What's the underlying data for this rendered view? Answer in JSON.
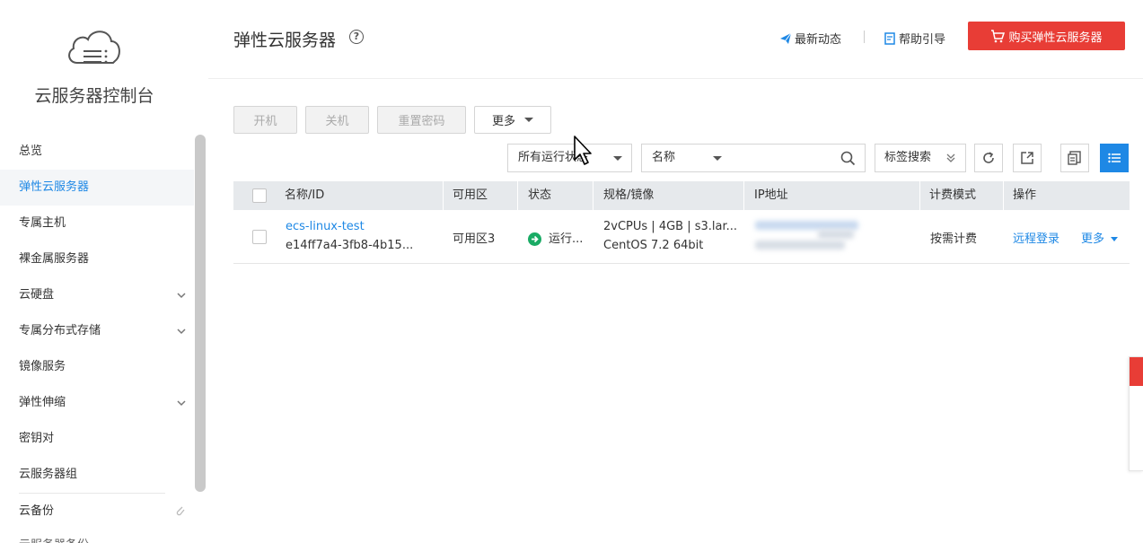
{
  "sidebar": {
    "title": "云服务器控制台",
    "items": [
      {
        "label": "总览"
      },
      {
        "label": "弹性云服务器",
        "active": true
      },
      {
        "label": "专属主机"
      },
      {
        "label": "裸金属服务器"
      },
      {
        "label": "云硬盘",
        "expandable": true
      },
      {
        "label": "专属分布式存储",
        "expandable": true
      },
      {
        "label": "镜像服务"
      },
      {
        "label": "弹性伸缩",
        "expandable": true
      },
      {
        "label": "密钥对"
      },
      {
        "label": "云服务器组"
      },
      {
        "label": "云备份",
        "external": true
      },
      {
        "label": "云服务器备份",
        "external": true
      }
    ]
  },
  "header": {
    "title": "弹性云服务器",
    "help_icon": "?",
    "news_label": "最新动态",
    "guide_label": "帮助引导",
    "buy_label": "购买弹性云服务器"
  },
  "toolbar": {
    "start_label": "开机",
    "stop_label": "关机",
    "reset_pwd_label": "重置密码",
    "more_label": "更多"
  },
  "filter": {
    "status_select": "所有运行状态",
    "field_select": "名称",
    "search_value": "",
    "tag_search_label": "标签搜索"
  },
  "table": {
    "columns": [
      "名称/ID",
      "可用区",
      "状态",
      "规格/镜像",
      "IP地址",
      "计费模式",
      "操作"
    ],
    "rows": [
      {
        "name": "ecs-linux-test",
        "id": "e14ff7a4-3fb8-4b15...",
        "zone": "可用区3",
        "status": "运行...",
        "spec": "2vCPUs | 4GB | s3.lar...",
        "image": "CentOS 7.2 64bit",
        "billing": "按需计费",
        "action_login": "远程登录",
        "action_more": "更多"
      }
    ]
  },
  "colors": {
    "accent": "#1e88e5",
    "buy_button": "#e83d36",
    "status_running": "#1aab65"
  }
}
